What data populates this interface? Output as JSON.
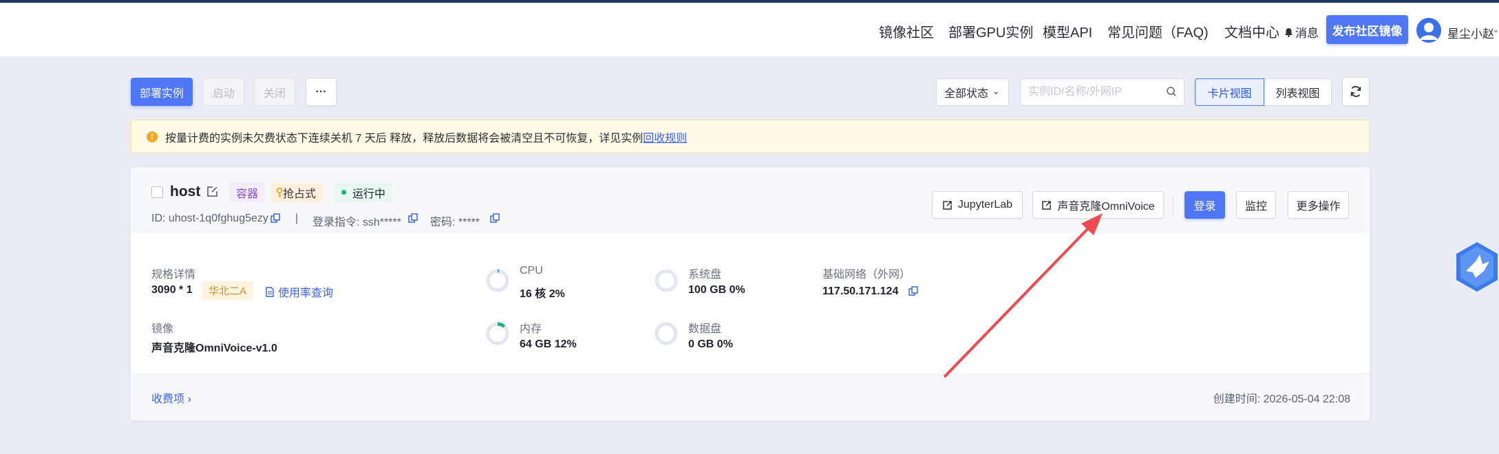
{
  "header": {
    "nav": [
      "镜像社区",
      "部署GPU实例",
      "模型API",
      "常见问题（FAQ)",
      "文档中心"
    ],
    "messages_label": "消息",
    "publish_label": "发布社区镜像",
    "username": "星尘小赵"
  },
  "toolbar": {
    "deploy_label": "部署实例",
    "start_label": "启动",
    "close_label": "关闭",
    "more_label": "···",
    "status_select": "全部状态",
    "search_placeholder": "实例ID/名称/外网IP",
    "view_card": "卡片视图",
    "view_list": "列表视图"
  },
  "notice": {
    "text": "按量计费的实例未欠费状态下连续关机 7 天后 释放，释放后数据将会被清空且不可恢复，详见实例",
    "link": "回收规则"
  },
  "instance": {
    "name": "host",
    "tag_type": "容器",
    "tag_billing": "抢占式",
    "status": "运行中",
    "id": "ID: uhost-1q0fghug5ezy",
    "separator": "|",
    "login_cmd": "登录指令: ssh*****",
    "password": "密码: *****",
    "actions": {
      "jupyter": "JupyterLab",
      "app": "声音克隆OmniVoice",
      "login": "登录",
      "monitor": "监控",
      "more": "更多操作"
    },
    "spec_label": "规格详情",
    "spec_value": "3090 * 1",
    "region": "华北二A",
    "usage_link": "使用率查询",
    "image_label": "镜像",
    "image_value": "声音克隆OmniVoice-v1.0",
    "cpu_label": "CPU",
    "cpu_value": "16 核 2%",
    "cpu_percent": 2,
    "mem_label": "内存",
    "mem_value": "64 GB 12%",
    "mem_percent": 12,
    "sysdisk_label": "系统盘",
    "sysdisk_value": "100 GB 0%",
    "sysdisk_percent": 0,
    "datadisk_label": "数据盘",
    "datadisk_value": "0 GB 0%",
    "datadisk_percent": 0,
    "network_label": "基础网络（外网）",
    "network_value": "117.50.171.124",
    "fee_link": "收费项 ›",
    "created": "创建时间: 2026-05-04 22:08"
  },
  "colors": {
    "primary": "#4f77f5",
    "ring_track": "#e3e6f2",
    "ring_green": "#19b47c",
    "arrow": "#ef4b4f"
  }
}
